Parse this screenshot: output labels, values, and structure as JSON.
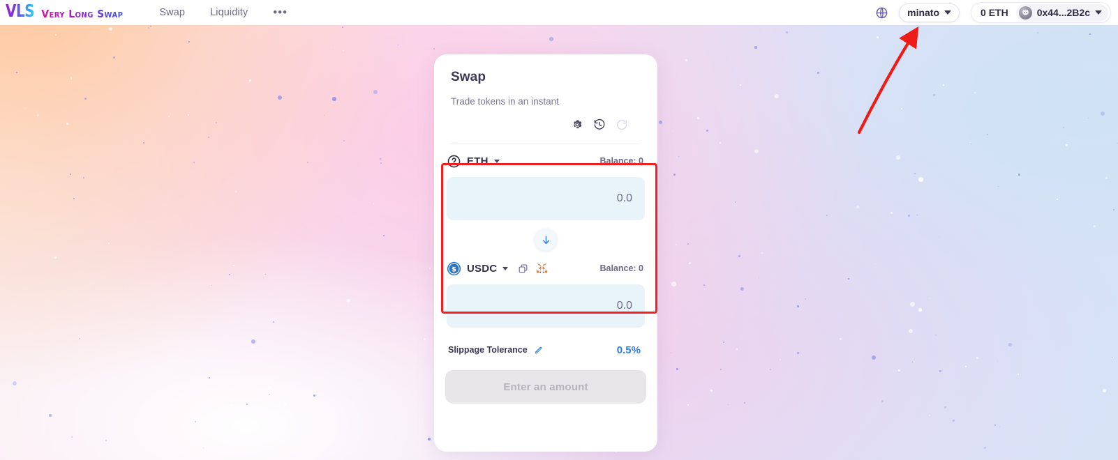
{
  "header": {
    "logo_mark": "VLS",
    "logo_text": "Very Long Swap",
    "nav": [
      {
        "label": "Swap"
      },
      {
        "label": "Liquidity"
      }
    ],
    "more_label": "•••",
    "globe_icon": "globe-icon",
    "network": {
      "label": "minato",
      "chevron_icon": "chevron-down-icon"
    },
    "wallet": {
      "balance": "0 ETH",
      "avatar_icon": "wallet-avatar-icon",
      "address": "0x44...2B2c",
      "chevron_icon": "chevron-down-icon"
    }
  },
  "swap_card": {
    "title": "Swap",
    "subtitle": "Trade tokens in an instant",
    "tools": [
      {
        "name": "settings-icon",
        "label": "Settings"
      },
      {
        "name": "history-icon",
        "label": "Transaction history"
      },
      {
        "name": "refresh-icon",
        "label": "Refresh"
      }
    ],
    "from": {
      "token_icon": "unknown-token-icon",
      "symbol": "ETH",
      "chevron_icon": "caret-down-icon",
      "balance_label": "Balance: 0",
      "amount_value": "",
      "amount_placeholder": "0.0"
    },
    "switch_icon": "arrow-down-icon",
    "to": {
      "token_icon": "usdc-token-icon",
      "symbol": "USDC",
      "chevron_icon": "caret-down-icon",
      "copy_icon": "copy-icon",
      "wallet_add_icon": "metamask-fox-icon",
      "balance_label": "Balance: 0",
      "amount_value": "",
      "amount_placeholder": "0.0"
    },
    "slippage": {
      "label": "Slippage Tolerance",
      "edit_icon": "pencil-icon",
      "value": "0.5%"
    },
    "submit_label": "Enter an amount"
  },
  "annotations": {
    "highlight_box_color": "#f42020",
    "arrow_color": "#ef1b16",
    "arrow_target": "network-pill"
  },
  "colors": {
    "accent_blue": "#2b7ce8",
    "text_dark": "#34304a",
    "text_muted": "#7b7596",
    "input_bg": "#e9f3fa",
    "card_bg": "#ffffff"
  }
}
